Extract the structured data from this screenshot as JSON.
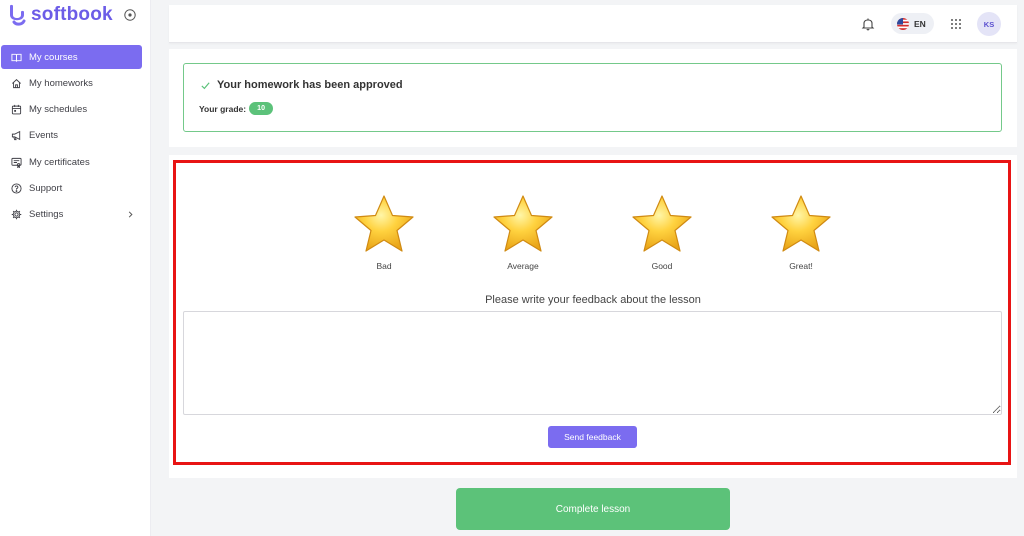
{
  "brand": {
    "name": "softbook",
    "accent": "#6c5ce7"
  },
  "sidebar": {
    "items": [
      {
        "label": "My courses",
        "icon": "book-icon",
        "active": true
      },
      {
        "label": "My homeworks",
        "icon": "home-icon"
      },
      {
        "label": "My schedules",
        "icon": "calendar-icon"
      },
      {
        "label": "Events",
        "icon": "megaphone-icon"
      },
      {
        "label": "My certificates",
        "icon": "certificate-icon"
      },
      {
        "label": "Support",
        "icon": "help-circle-icon"
      },
      {
        "label": "Settings",
        "icon": "gear-icon",
        "expandable": true
      }
    ]
  },
  "topbar": {
    "language": "EN",
    "avatar_initials": "KS"
  },
  "homework": {
    "status_text": "Your homework has been approved",
    "grade_label": "Your grade:",
    "grade_value": "10"
  },
  "feedback": {
    "ratings": [
      {
        "label": "Bad"
      },
      {
        "label": "Average"
      },
      {
        "label": "Good"
      },
      {
        "label": "Great!"
      }
    ],
    "prompt": "Please write your feedback about the lesson",
    "input_value": "",
    "send_label": "Send feedback"
  },
  "complete_label": "Complete lesson",
  "colors": {
    "primary": "#7b6cf0",
    "success": "#5cc279",
    "highlight": "#e81414"
  }
}
